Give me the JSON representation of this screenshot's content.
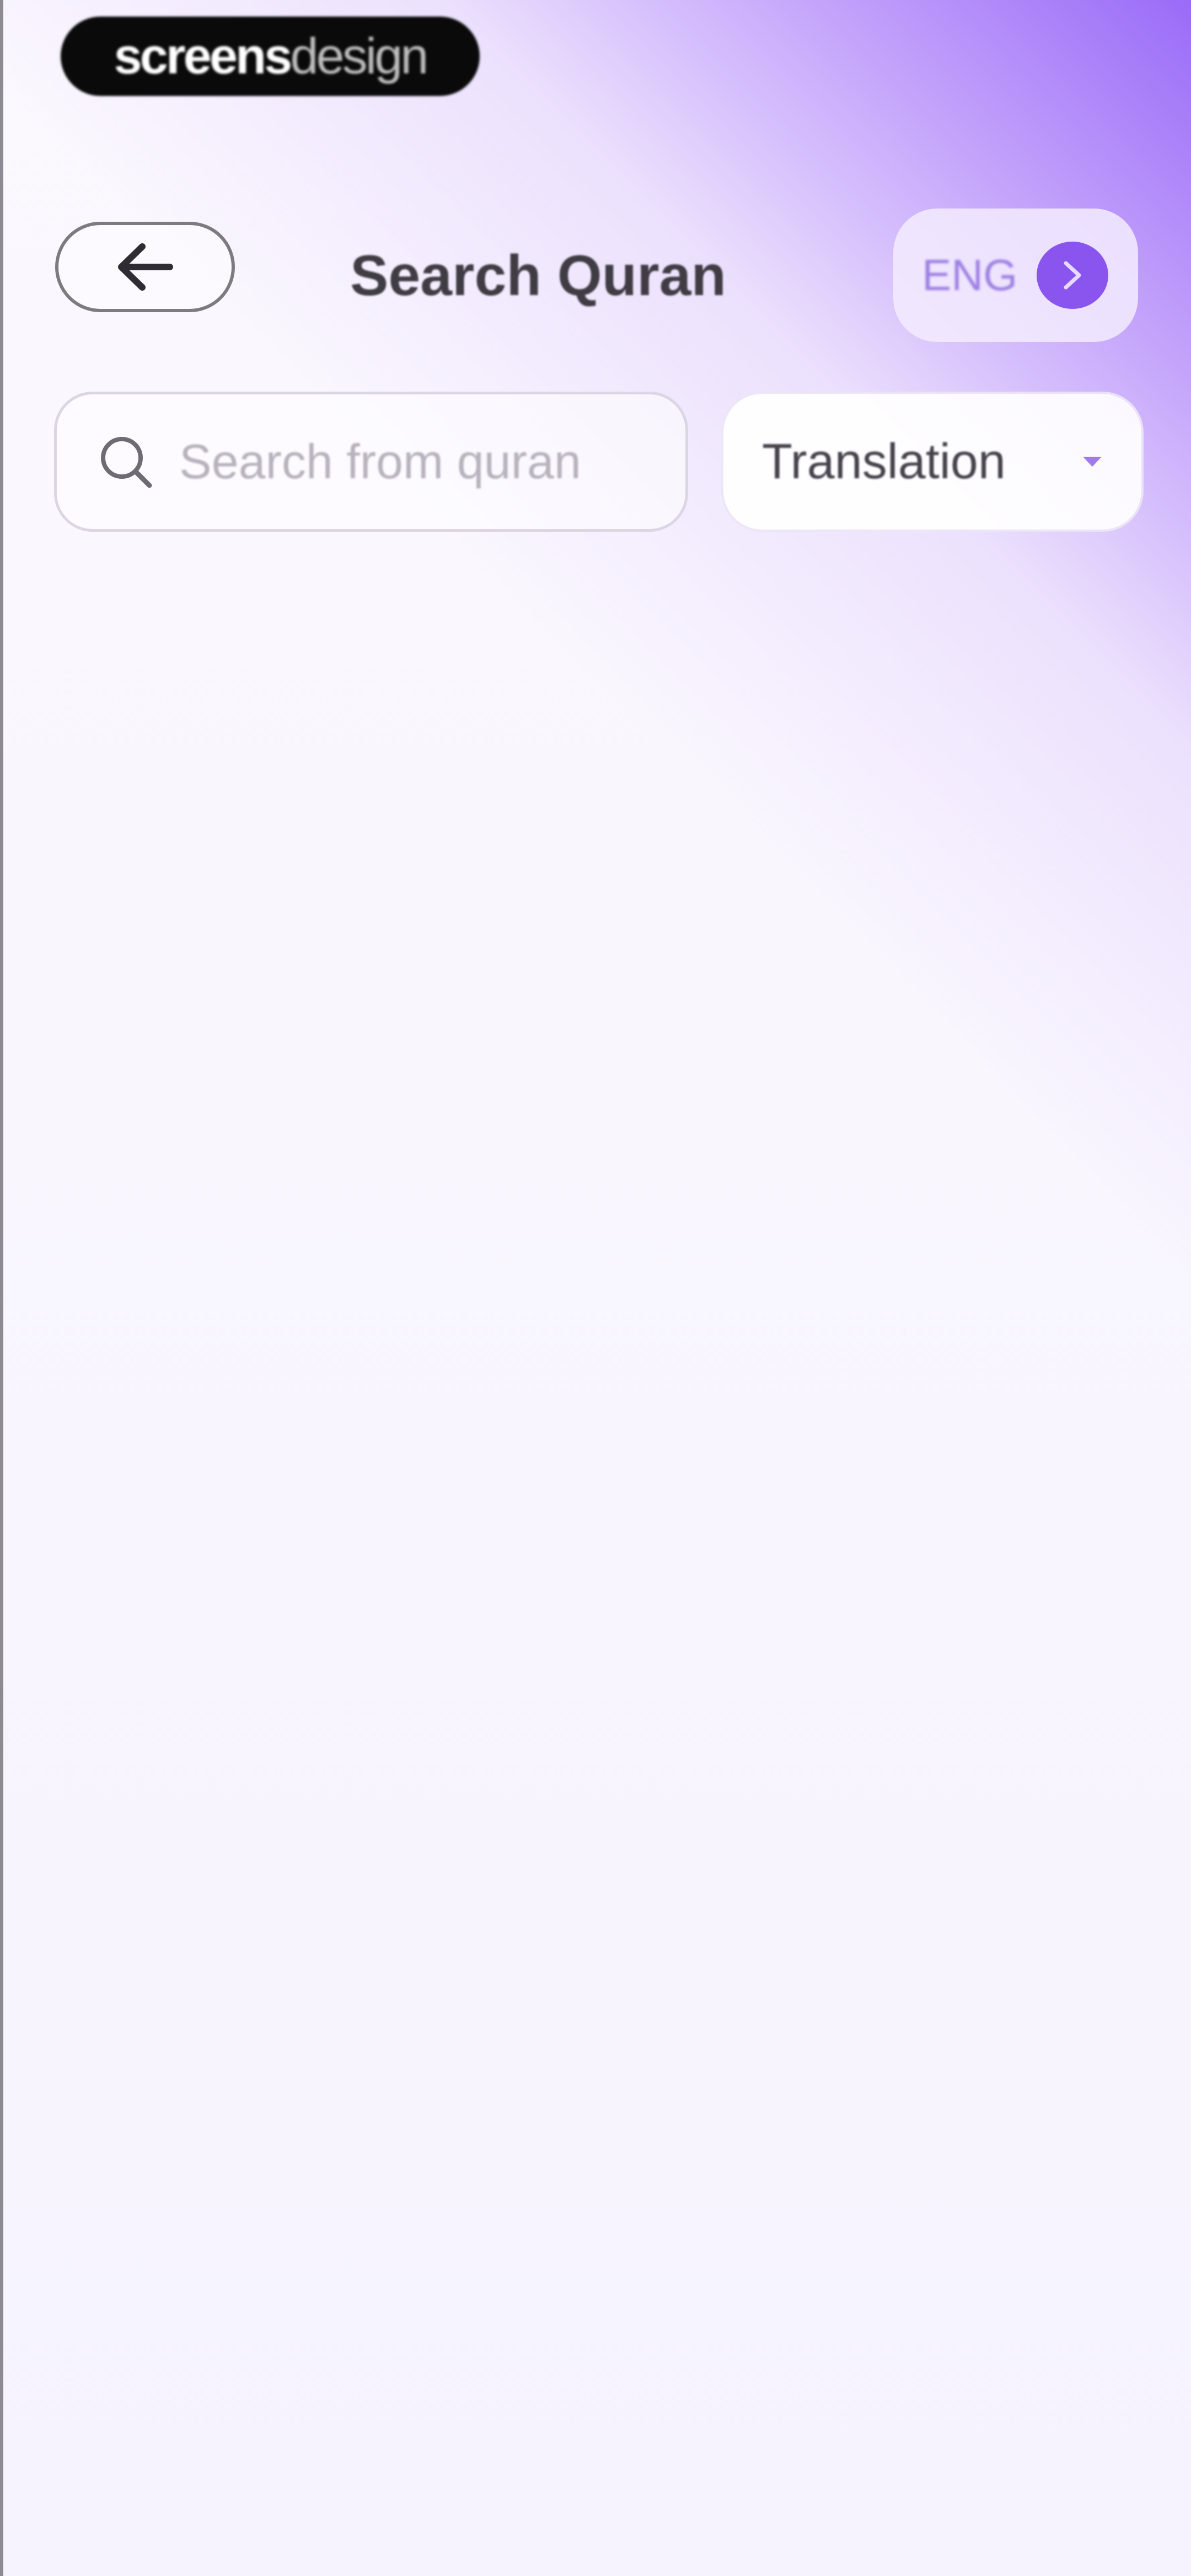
{
  "watermark": {
    "part1": "screens",
    "part2": "design"
  },
  "header": {
    "title": "Search Quran",
    "language": {
      "label": "ENG"
    }
  },
  "search": {
    "placeholder": "Search from quran",
    "value": ""
  },
  "filter": {
    "selected": "Translation"
  },
  "icons": {
    "back": "arrow-left-icon",
    "search": "search-icon",
    "language_next": "chevron-right-icon",
    "filter_toggle": "chevron-down-icon"
  },
  "colors": {
    "accent": "#8a55ef",
    "accent_text": "#9d80e2",
    "title_text": "#3f3c44",
    "background": "#f7f4fe"
  }
}
